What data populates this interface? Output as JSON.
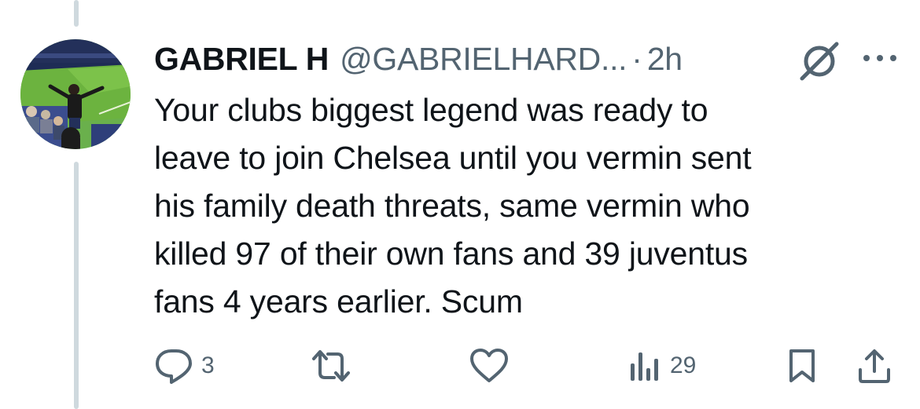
{
  "tweet": {
    "display_name": "GABRIEL H",
    "handle": "@GABRIELHARD...",
    "separator": "·",
    "time": "2h",
    "text": "Your clubs biggest legend was ready to\nleave to join Chelsea until you vermin sent\nhis family death threats, same vermin who\nkilled 97 of their own fans and 39 juventus\nfans 4 years earlier. Scum"
  },
  "actions": {
    "replies": "3",
    "views": "29"
  },
  "icons": [
    "grok-icon",
    "more-icon",
    "reply-icon",
    "retweet-icon",
    "like-icon",
    "views-icon",
    "bookmark-icon",
    "share-icon"
  ],
  "colors": {
    "text_primary": "#0f1419",
    "text_secondary": "#536471",
    "thread_line": "#cfd9de"
  }
}
